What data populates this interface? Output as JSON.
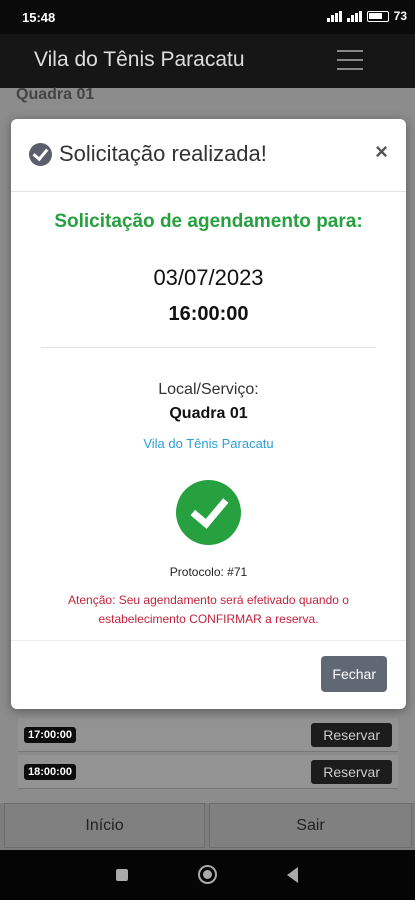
{
  "statusbar": {
    "time": "15:48",
    "battery": "73"
  },
  "app": {
    "title": "Vila do Tênis Paracatu",
    "menu_icon": "hamburger-icon"
  },
  "background": {
    "court_label": "Quadra 01",
    "slots": [
      {
        "time": "17:00:00",
        "action": "Reservar"
      },
      {
        "time": "18:00:00",
        "action": "Reservar"
      }
    ]
  },
  "modal": {
    "title": "Solicitação realizada!",
    "heading": "Solicitação de agendamento para:",
    "date": "03/07/2023",
    "time": "16:00:00",
    "local_label": "Local/Serviço:",
    "local_value": "Quadra 01",
    "establishment": "Vila do Tênis Paracatu",
    "protocol": "Protocolo: #71",
    "warning": "Atenção: Seu agendamento será efetivado quando o estabelecimento CONFIRMAR a reserva.",
    "close_label": "Fechar",
    "colors": {
      "success": "#27a03f",
      "warning": "#c0233d",
      "link": "#2a9fd6"
    }
  },
  "footer": {
    "home_label": "Início",
    "exit_label": "Sair"
  }
}
